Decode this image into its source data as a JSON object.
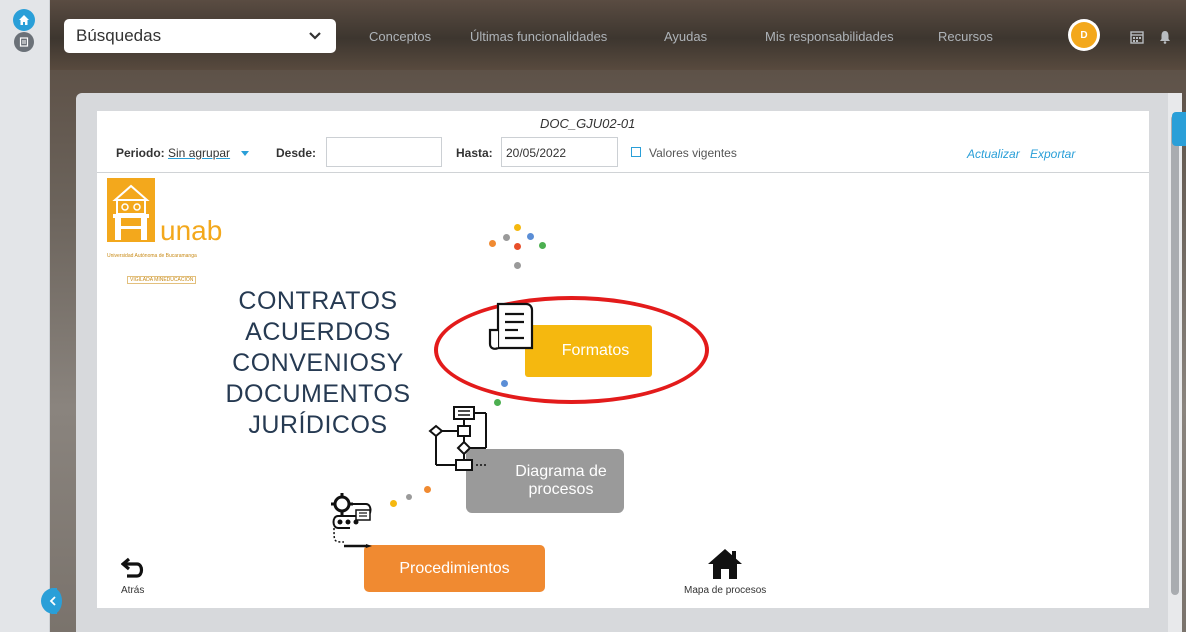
{
  "topbar": {
    "search_value": "Búsquedas",
    "nav": [
      "Conceptos",
      "Últimas funcionalidades",
      "Ayudas",
      "Mis responsabilidades",
      "Recursos"
    ],
    "avatar_text": "D"
  },
  "filters": {
    "doc_code": "DOC_GJU02-01",
    "periodo_label": "Periodo:",
    "periodo_value": "Sin agrupar",
    "desde_label": "Desde:",
    "desde_value": "",
    "hasta_label": "Hasta:",
    "hasta_value": "20/05/2022",
    "vigentes_label": "Valores vigentes",
    "actualizar": "Actualizar",
    "exportar": "Exportar"
  },
  "logo": {
    "word": "unab",
    "subtitle": "Universidad Autónoma de Bucaramanga",
    "tag": "VIGILADA MINEDUCACIÓN"
  },
  "main": {
    "title_lines": [
      "CONTRATOS",
      "ACUERDOS",
      "CONVENIOSY",
      "DOCUMENTOS",
      "JURÍDICOS"
    ],
    "formatos": "Formatos",
    "diagrama": "Diagrama de procesos",
    "procedimientos": "Procedimientos",
    "back": "Atrás",
    "mapa": "Mapa de procesos"
  },
  "colors": {
    "accent": "#2a9fd8",
    "yellow": "#f5b80f",
    "orange": "#f08a31",
    "gray_box": "#9a9a9a",
    "highlight": "#e31b1b"
  }
}
